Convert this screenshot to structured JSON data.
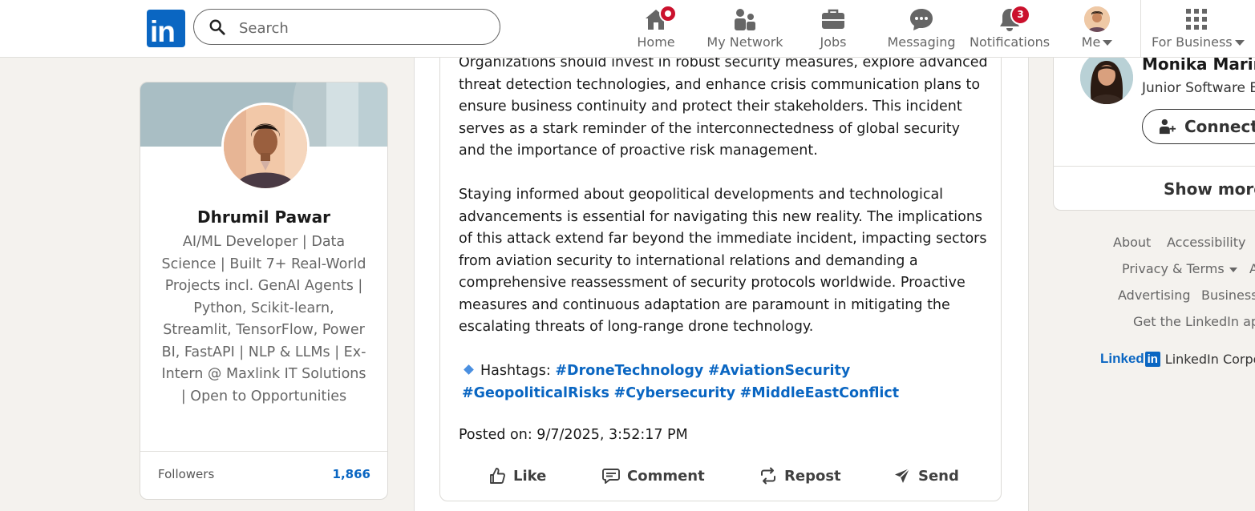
{
  "nav": {
    "logo_text": "in",
    "search_placeholder": "Search",
    "items": [
      {
        "label": "Home",
        "icon": "home-icon"
      },
      {
        "label": "My Network",
        "icon": "people-icon"
      },
      {
        "label": "Jobs",
        "icon": "briefcase-icon"
      },
      {
        "label": "Messaging",
        "icon": "chat-icon"
      },
      {
        "label": "Notifications",
        "icon": "bell-icon",
        "badge": "3"
      },
      {
        "label": "Me",
        "icon": "avatar"
      },
      {
        "label": "For Business",
        "icon": "grid-icon"
      }
    ]
  },
  "profile": {
    "name": "Dhrumil Pawar",
    "headline": "AI/ML Developer | Data Science | Built 7+ Real-World Projects incl. GenAI Agents | Python, Scikit-learn, Streamlit, TensorFlow, Power BI, FastAPI | NLP & LLMs | Ex-Intern @ Maxlink IT Solutions | Open to Opportunities",
    "followers_label": "Followers",
    "followers_value": "1,866"
  },
  "post": {
    "para1": "Organizations should invest in robust security measures, explore advanced threat detection technologies, and enhance crisis communication plans to ensure business continuity and protect their stakeholders. This incident serves as a stark reminder of the interconnectedness of global security and the importance of proactive risk management.",
    "para2": "Staying informed about geopolitical developments and technological advancements is essential for navigating this new reality. The implications of this attack extend far beyond the immediate incident, impacting sectors from aviation security to international relations and demanding a comprehensive reassessment of security protocols worldwide. Proactive measures and continuous adaptation are paramount in mitigating the escalating threats of long-range drone technology.",
    "hashtags_label": "Hashtags:",
    "hashtags": [
      "#DroneTechnology",
      "#AviationSecurity",
      "#GeopoliticalRisks",
      "#Cybersecurity",
      "#MiddleEastConflict"
    ],
    "posted": "Posted on: 9/7/2025, 3:52:17 PM",
    "actions": [
      "Like",
      "Comment",
      "Repost",
      "Send"
    ]
  },
  "suggestion": {
    "name": "Monika Marine",
    "title": "Junior Software E",
    "connect_label": "Connect",
    "show_more": "Show more"
  },
  "footer": {
    "about": "About",
    "accessibility": "Accessibility",
    "privacy": "Privacy & Terms",
    "privacy_cut": "A",
    "advertising": "Advertising",
    "business": "Business",
    "get_app": "Get the LinkedIn app",
    "brand_word": "Linked",
    "brand_box": "in",
    "corp": "LinkedIn Corpo"
  },
  "colors": {
    "brand": "#0a66c2",
    "badge": "#cb112d",
    "background": "#f4f2ee"
  }
}
